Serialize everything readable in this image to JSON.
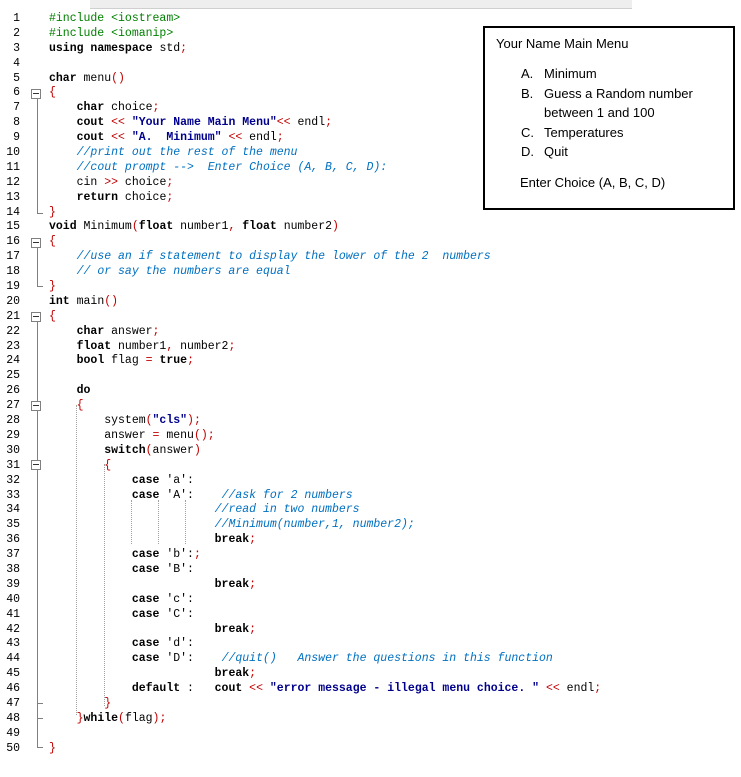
{
  "editor": {
    "lines": [
      "#include <iostream>",
      "#include <iomanip>",
      "using namespace std;",
      "",
      "char menu()",
      "{",
      "    char choice;",
      "    cout << \"Your Name Main Menu\"<< endl;",
      "    cout << \"A.  Minimum\" << endl;",
      "    //print out the rest of the menu",
      "    //cout prompt -->  Enter Choice (A, B, C, D):",
      "    cin >> choice;",
      "    return choice;",
      "}",
      "void Minimum(float number1, float number2)",
      "{",
      "    //use an if statement to display the lower of the 2  numbers",
      "    // or say the numbers are equal",
      "}",
      "int main()",
      "{",
      "    char answer;",
      "    float number1, number2;",
      "    bool flag = true;",
      "",
      "    do",
      "    {",
      "        system(\"cls\");",
      "        answer = menu();",
      "        switch(answer)",
      "        {",
      "            case 'a':",
      "            case 'A':    //ask for 2 numbers",
      "                        //read in two numbers",
      "                        //Minimum(number,1, number2);",
      "                        break;",
      "            case 'b':;",
      "            case 'B':",
      "                        break;",
      "            case 'c':",
      "            case 'C':",
      "                        break;",
      "            case 'd':",
      "            case 'D':    //quit()   Answer the questions in this function",
      "                        break;",
      "            default :   cout << \"error message - illegal menu choice. \" << endl;",
      "        }",
      "    }while(flag);",
      "",
      "}"
    ]
  },
  "menu_panel": {
    "title": "Your Name Main Menu",
    "items": [
      {
        "letter": "A.",
        "text": "Minimum"
      },
      {
        "letter": "B.",
        "text": "Guess a Random number between 1 and 100"
      },
      {
        "letter": "C.",
        "text": "Temperatures"
      },
      {
        "letter": "D.",
        "text": "Quit"
      }
    ],
    "prompt": "Enter Choice (A, B, C, D)"
  }
}
